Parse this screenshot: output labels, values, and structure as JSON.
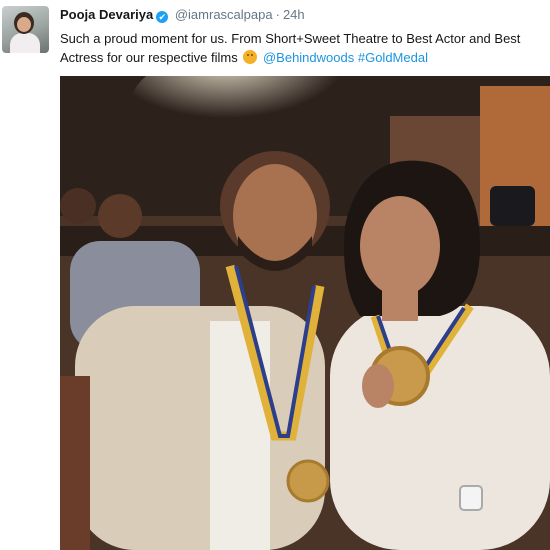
{
  "tweet": {
    "author_name": "Pooja Devariya",
    "handle": "@iamrascalpapa",
    "separator": "·",
    "time": "24h",
    "verified_mark": "✔",
    "text_line1": "Such a proud moment for us. From Short+Sweet Theatre to Best Actor and Best",
    "text_line2_before": "Actress for our respective films",
    "mention": "@Behindwoods",
    "hashtag": "#GoldMedal",
    "emoji": "smiling-face-icon"
  },
  "colors": {
    "link": "#1b95e0",
    "verified": "#1da1f2",
    "muted": "#657786",
    "text": "#14171a"
  }
}
